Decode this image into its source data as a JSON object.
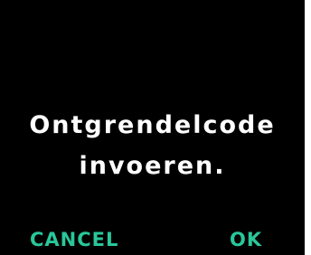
{
  "message": {
    "line1": "Ontgrendelcode",
    "line2": "invoeren."
  },
  "softkeys": {
    "left_label": "CANCEL",
    "right_label": "OK"
  },
  "colors": {
    "screen_background": "#000000",
    "message_text": "#ffffff",
    "softkey_text": "#29c79a"
  }
}
